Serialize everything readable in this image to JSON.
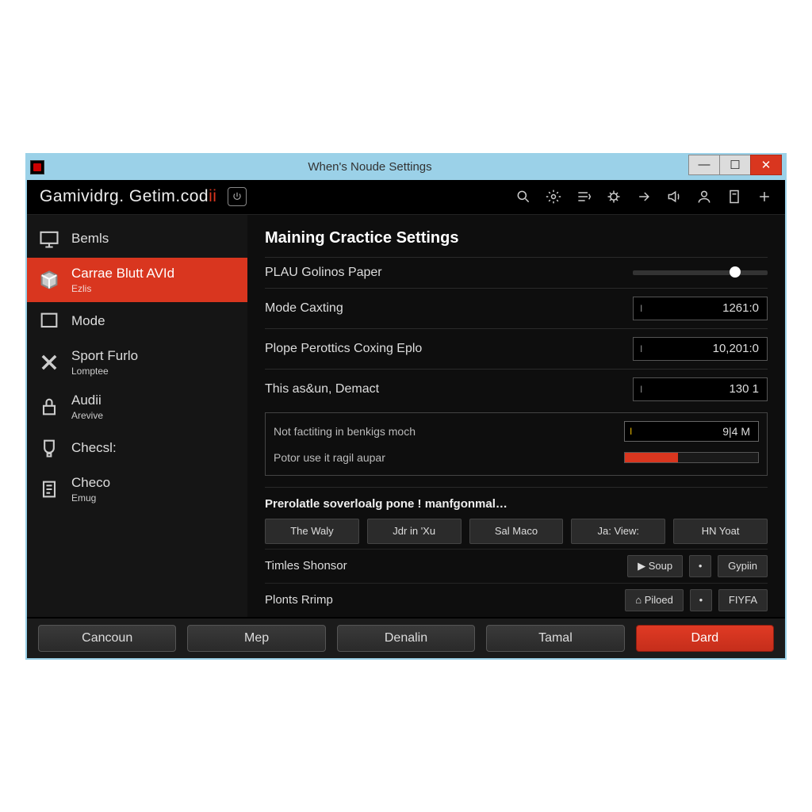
{
  "window": {
    "title": "When's Noude Settings"
  },
  "brand": {
    "part1": "Gamividrg. ",
    "part2": "Getim.cod",
    "accent": "ii"
  },
  "toolbar_icons": [
    "search",
    "gear",
    "list",
    "bug",
    "forward",
    "speaker",
    "user",
    "doc",
    "plus"
  ],
  "sidebar": {
    "items": [
      {
        "label": "Bemls",
        "sub": "",
        "icon": "monitor"
      },
      {
        "label": "Carrae Blutt AVId",
        "sub": "Ezlis",
        "icon": "box",
        "active": true
      },
      {
        "label": "Mode",
        "sub": "",
        "icon": "square"
      },
      {
        "label": "Sport Furlo",
        "sub": "Lomptee",
        "icon": "x"
      },
      {
        "label": "Audii",
        "sub": "Arevive",
        "icon": "lock"
      },
      {
        "label": "Checsl:",
        "sub": "",
        "icon": "cup"
      },
      {
        "label": "Checo",
        "sub": "Emug",
        "icon": "clipboard"
      }
    ]
  },
  "main": {
    "title": "Maining Cractice Settings",
    "rows": [
      {
        "label": "PLAU Golinos Paper",
        "type": "slider",
        "pos": 72
      },
      {
        "label": "Mode Caxting",
        "type": "value",
        "value": "1261:0"
      },
      {
        "label": "Plope Perottics Coxing Eplo",
        "type": "value",
        "value": "10,201:0"
      },
      {
        "label": "This as&un, Demact",
        "type": "value",
        "value": "130  1"
      }
    ],
    "subbox": {
      "rows": [
        {
          "label": "Not factiting in benkigs moch",
          "type": "mini",
          "value": "9|4  M"
        },
        {
          "label": "Potor use it ragil aupar",
          "type": "progress",
          "pct": 40
        }
      ]
    },
    "section2": {
      "heading": "Prerolatle soverloalg pone ! manfgonmal…",
      "pills": [
        "The Waly",
        "Jdr in 'Xu",
        "Sal Maco",
        "Ja: View:",
        "HN Yoat"
      ],
      "actions": [
        {
          "label": "Timles Shonsor",
          "buttons": [
            {
              "t": "▶ Soup"
            },
            {
              "t": "•",
              "sm": true
            },
            {
              "t": "Gypiin"
            }
          ]
        },
        {
          "label": "Plonts Rrimp",
          "buttons": [
            {
              "t": "⌂ Piloed"
            },
            {
              "t": "•",
              "sm": true
            },
            {
              "t": "FIYFA"
            }
          ]
        }
      ]
    }
  },
  "footer": {
    "buttons": [
      "Cancoun",
      "Mep",
      "Denalin",
      "Tamal",
      "Dard"
    ]
  },
  "colors": {
    "accent": "#d9361f"
  }
}
